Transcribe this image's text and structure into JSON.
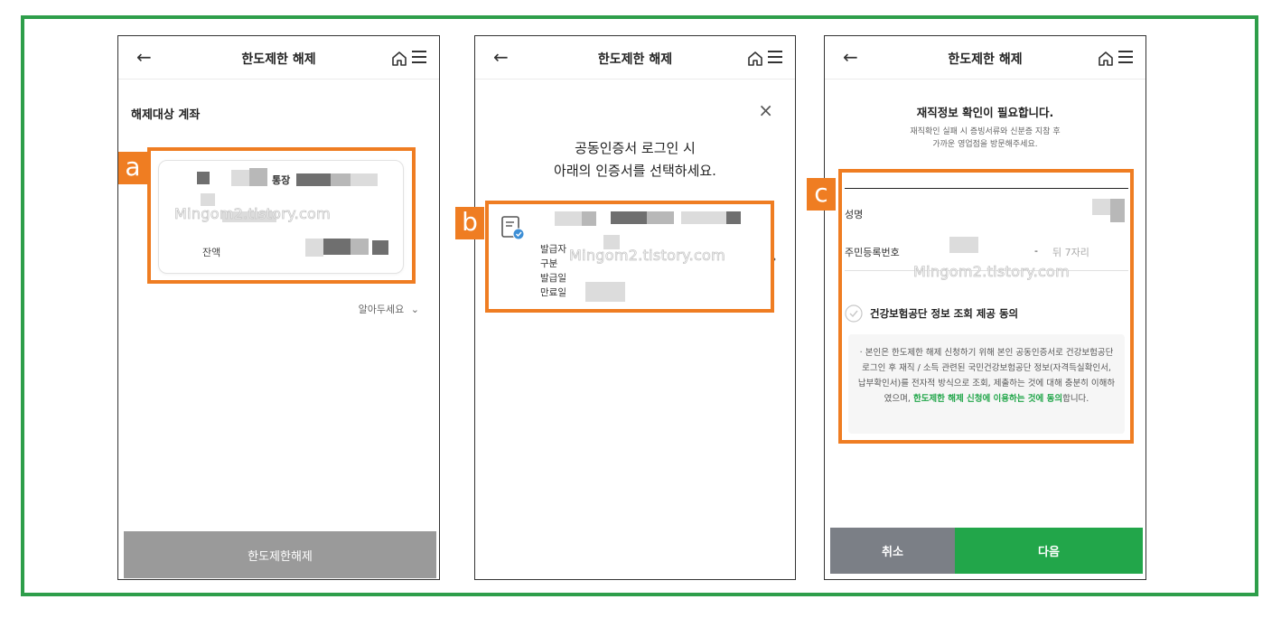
{
  "screens": [
    {
      "title": "한도제한 해제",
      "section_label": "해제대상 계좌",
      "account_type": "통장",
      "balance_label": "잔액",
      "info_toggle": "알아두세요",
      "submit_label": "한도제한해제",
      "marker": "a"
    },
    {
      "title": "한도제한 해제",
      "prompt_line1": "공동인증서 로그인 시",
      "prompt_line2": "아래의 인증서를 선택하세요.",
      "cert_fields": [
        "발급자",
        "구분",
        "발급일",
        "만료일"
      ],
      "marker": "b"
    },
    {
      "title": "한도제한 해제",
      "heading": "재직정보 확인이 필요합니다.",
      "sub_line1": "재직확인 실패 시 증빙서류와 신분증 지참 후",
      "sub_line2": "가까운 영업점을 방문해주세요.",
      "name_label": "성명",
      "rrn_label": "주민등록번호",
      "rrn_dash": "-",
      "rrn_back_placeholder": "뒤 7자리",
      "consent_label": "건강보험공단 정보 조회 제공 동의",
      "consent_text_prefix": "· 본인은 한도제한 해제 신청하기 위해 본인 공동인증서로 건강보험공단 로그인 후 재직 / 소득 관련된 국민건강보험공단 정보(자격득실확인서, 납부확인서)를 전자적 방식으로 조회, 제출하는 것에 대해 충분히 이해하였으며,",
      "consent_text_highlight": "한도제한 해제 신청에 이용하는 것에 동의",
      "consent_text_suffix": "합니다.",
      "cancel_label": "취소",
      "next_label": "다음",
      "marker": "c"
    }
  ],
  "watermark": "Mingom2.tistory.com",
  "colors": {
    "frame_border": "#2e9e4a",
    "highlight_box": "#ef7d22",
    "next_button": "#22a64a",
    "cancel_button": "#7b7f86",
    "disabled_button": "#9a9a9a",
    "consent_highlight": "#22a64a"
  },
  "icons": [
    "back-arrow-icon",
    "home-icon",
    "hamburger-menu-icon",
    "close-icon",
    "certificate-icon",
    "chevron-right-icon",
    "chevron-down-icon",
    "check-circle-icon"
  ]
}
